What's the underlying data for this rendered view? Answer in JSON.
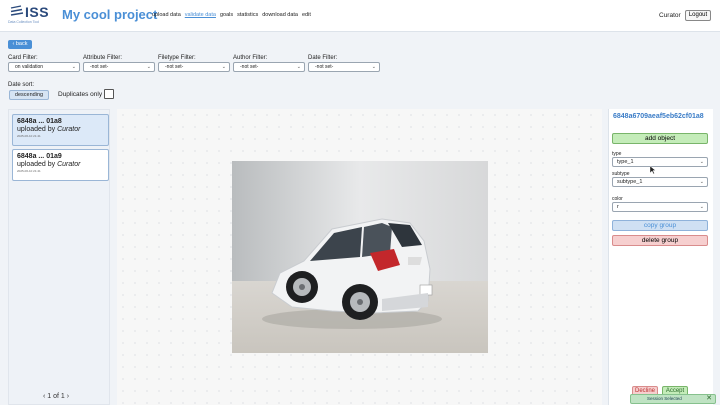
{
  "header": {
    "logo_text": "ISS",
    "logo_sub": "Data Collection Tool",
    "app_title": "My cool project",
    "nav": [
      "upload data",
      "validate data",
      "goals",
      "statistics",
      "download data",
      "edit"
    ],
    "nav_active": "validate data",
    "user": "Curator",
    "logout_label": "Logout"
  },
  "back_label": "back",
  "filters": {
    "card": {
      "label": "Card Filter:",
      "value": "on validation"
    },
    "attribute": {
      "label": "Attribute Filter:",
      "value": "-not set-"
    },
    "filetype": {
      "label": "Filetype Filter:",
      "value": "-not set-"
    },
    "author": {
      "label": "Author Filter:",
      "value": "-not set-"
    },
    "date": {
      "label": "Date Filter:",
      "value": "-not set-"
    }
  },
  "sort": {
    "label": "Date sort:",
    "value": "descending"
  },
  "duplicates_label": "Duplicates only",
  "cards": [
    {
      "id": "6848a ... 01a8",
      "uploaded": "uploaded by ",
      "author": "Curator",
      "date": "2025-06-10 21:41",
      "selected": true
    },
    {
      "id": "6848a ... 01a9",
      "uploaded": "uploaded by ",
      "author": "Curator",
      "date": "2025-06-10 21:41",
      "selected": false
    }
  ],
  "pager": {
    "text": "1 of 1"
  },
  "panel": {
    "object_id": "6848a6709aeaf5eb62cf01a8",
    "add_object_label": "add object",
    "type_label": "type",
    "type_value": "type_1",
    "subtype_label": "subtype",
    "subtype_value": "subtype_1",
    "color_label": "color",
    "color_value": "r",
    "copy_group_label": "copy group",
    "delete_group_label": "delete group"
  },
  "actions": {
    "decline": "Decline",
    "accept": "Accept"
  },
  "toast": {
    "text": "Session Selected"
  },
  "colors": {
    "accent": "#4a8fd6",
    "success": "#c4ecb9",
    "danger": "#f6cfcf"
  }
}
